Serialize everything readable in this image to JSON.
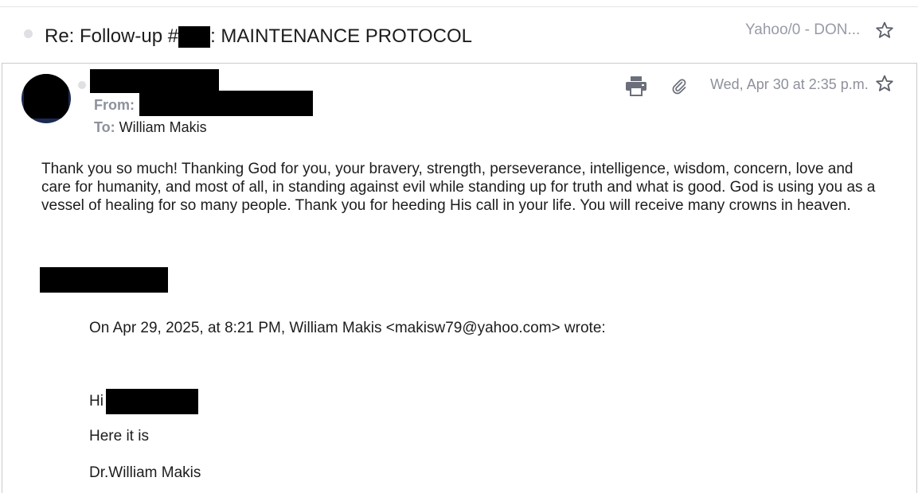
{
  "subject": {
    "prefix": "Re: Follow-up #",
    "suffix": ": MAINTENANCE PROTOCOL"
  },
  "folder_label": "Yahoo/0 - DON...",
  "message": {
    "from_label": "From:",
    "to_label": "To:",
    "to_value": "William Makis",
    "date": "Wed, Apr 30 at 2:35 p.m.",
    "body": "Thank you so much! Thanking God for you, your bravery, strength, perseverance, intelligence, wisdom, concern, love and care for humanity, and most of all, in standing against evil while standing up for truth and what is good. God is using you as a vessel of healing for so many people. Thank you for heeding His call in your life. You will receive many crowns in heaven."
  },
  "quoted": {
    "header": "On Apr 29, 2025, at 8:21 PM, William Makis <makisw79@yahoo.com> wrote:",
    "greeting": "Hi",
    "line1": "Here it is",
    "signature": "Dr.William Makis"
  },
  "icons": {
    "subject_dot": "unread-dot-icon",
    "star": "star-icon",
    "print": "print-icon",
    "attachment": "paperclip-icon"
  },
  "colors": {
    "muted_text": "#8e919b",
    "folder_text": "#979ba7",
    "border": "#c9cbcf"
  }
}
